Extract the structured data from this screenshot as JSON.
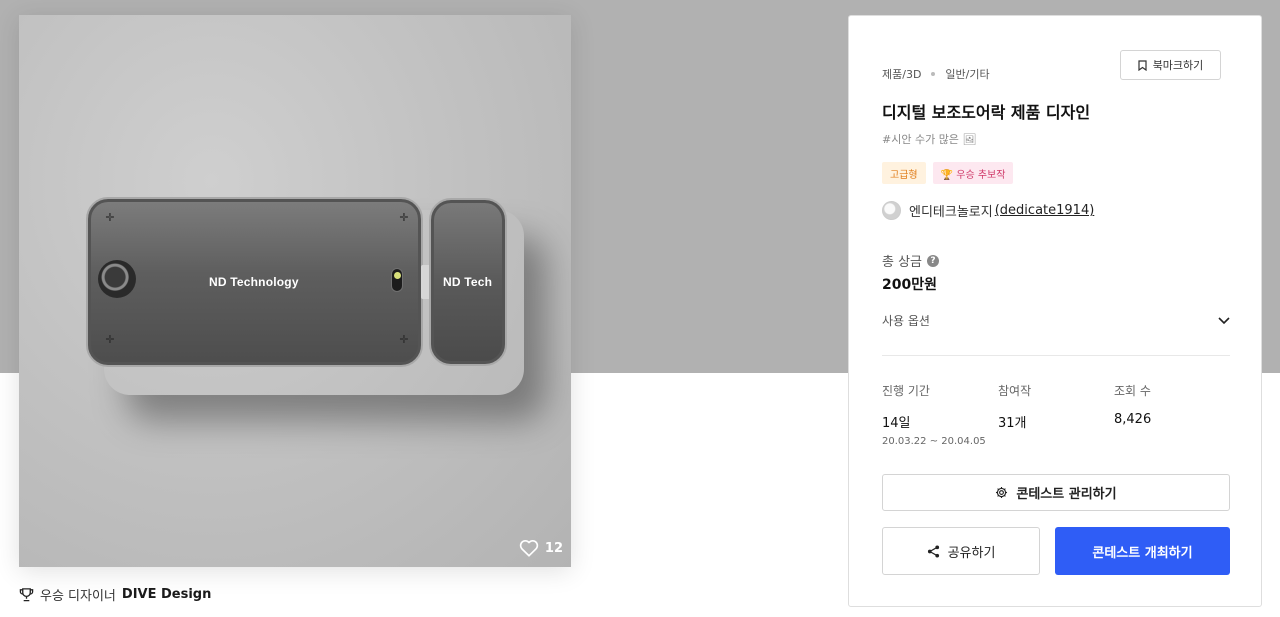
{
  "colors": {
    "accent": "#2f5df6",
    "header_band": "#b1b1b1",
    "badge_premium_bg": "#fff2df",
    "badge_premium_text": "#e07d1b",
    "badge_winner_bg": "#fde8f0",
    "badge_winner_text": "#d03a6a"
  },
  "image": {
    "product_label_main": "ND Technology",
    "product_label_side": "ND Tech",
    "like_icon": "heart-icon",
    "like_count": "12"
  },
  "caption": {
    "icon": "trophy-icon",
    "prefix": "우승 디자이너",
    "designer": "DIVE Design"
  },
  "contest": {
    "category": "제품/3D",
    "subcategory": "일반/기타",
    "bookmark_label": "북마크하기",
    "title": "디지털 보조도어락 제품 디자인",
    "hashtag": "#시안 수가 많은 🖼",
    "badge_premium": "고급형",
    "badge_winner": "🏆 우승 추보작",
    "host_name": "엔디테크놀로지",
    "host_handle": "(dedicate1914)",
    "prize_label": "총 상금",
    "prize_value": "200만원",
    "usage_label": "사용 옵션",
    "stats": {
      "duration_label": "진행 기간",
      "duration_value": "14일",
      "duration_range": "20.03.22 ~ 20.04.05",
      "participants_label": "참여작",
      "participants_value": "31개",
      "views_label": "조회 수",
      "views_value": "8,426"
    },
    "manage_label": "콘테스트 관리하기",
    "share_label": "공유하기",
    "host_contest_label": "콘테스트 개최하기"
  }
}
